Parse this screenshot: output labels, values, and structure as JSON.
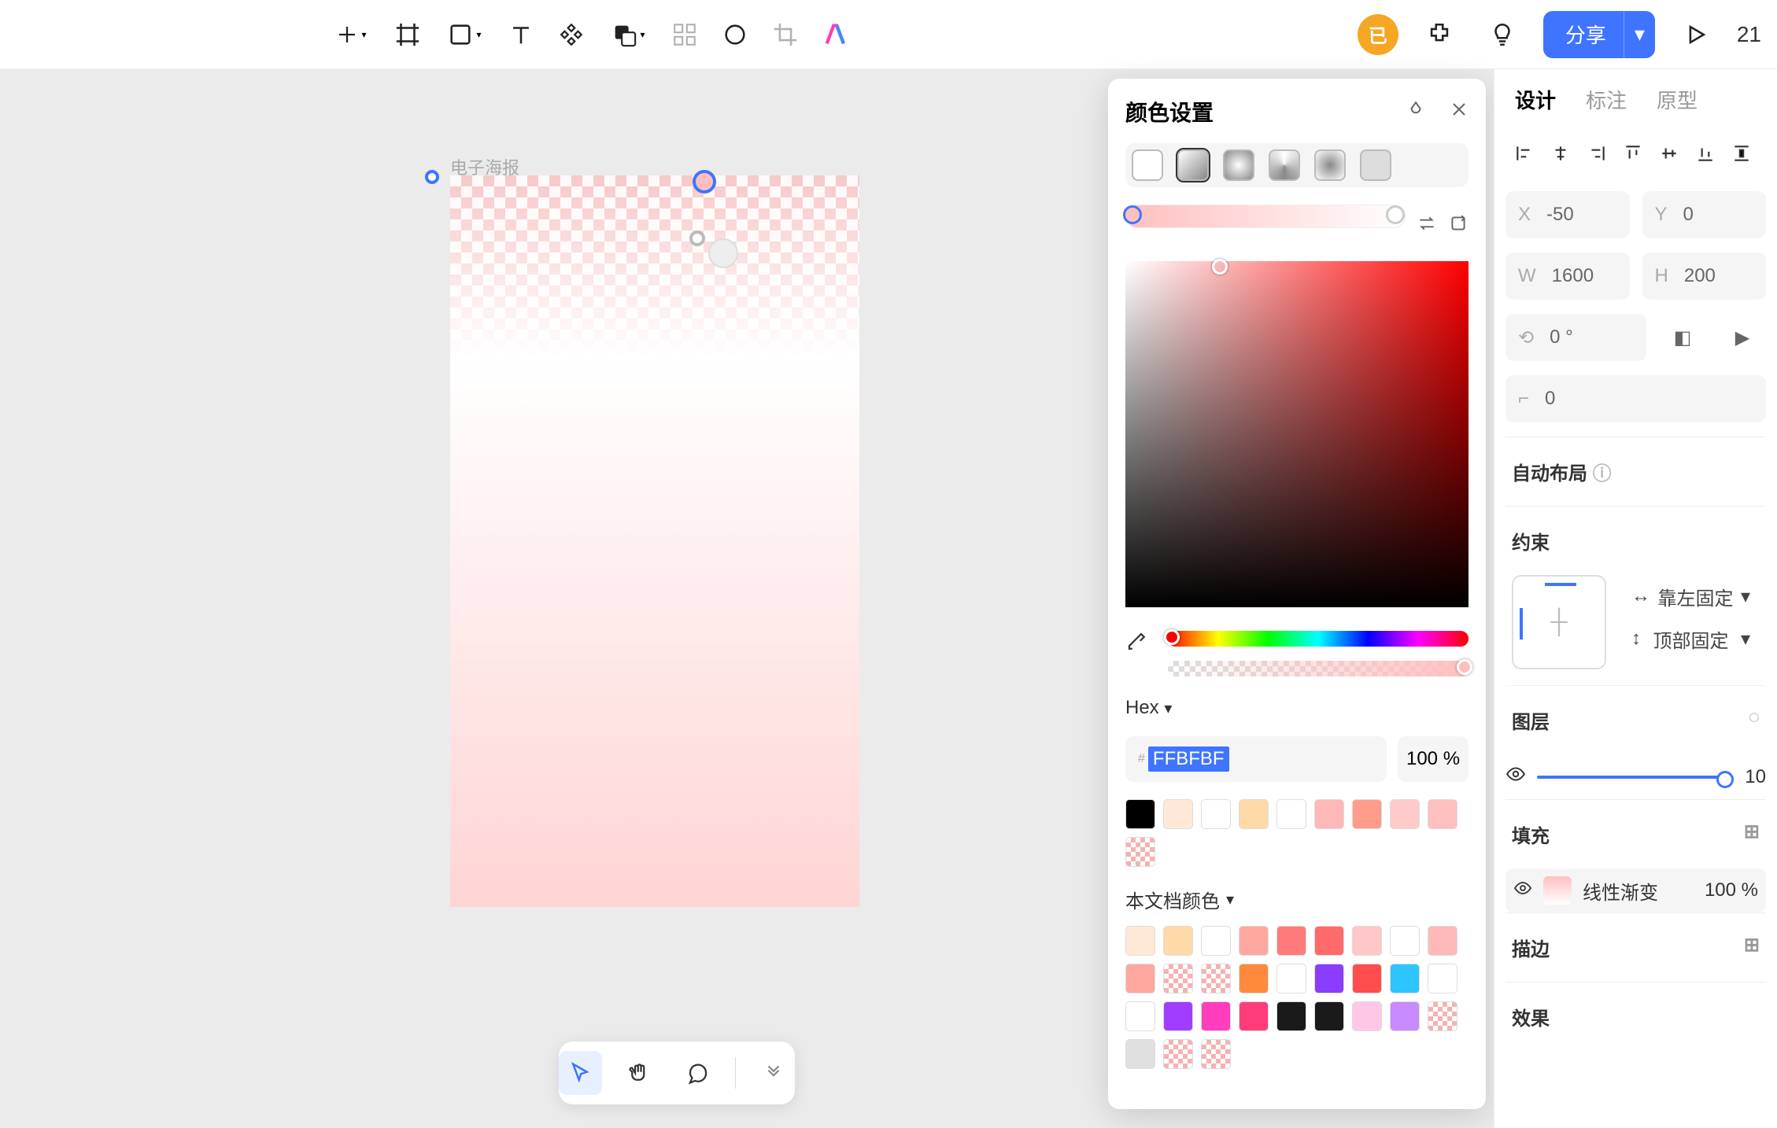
{
  "toolbar": {
    "badge": "已",
    "shareLabel": "分享",
    "percent": "21"
  },
  "canvas": {
    "frameLabel": "电子海报"
  },
  "colorPopup": {
    "title": "颜色设置",
    "hexMode": "Hex",
    "hexValue": "FFBFBF",
    "opacity": "100",
    "opacityUnit": "%",
    "docColorsLabel": "本文档颜色",
    "swatches1": [
      "#000000",
      "#ffe9d6",
      "#ffffff",
      "#ffd9a8",
      "#ffffff",
      "#ffb8b8",
      "#ff9c8a",
      "#ffcaca",
      "#ffbfbf",
      "transparent"
    ],
    "docSwatches": [
      "#ffe9d6",
      "#ffd9a8",
      "#ffffff",
      "#ffa8a0",
      "#ff7a7a",
      "#ff6a6a",
      "#ffc7c7",
      "#ffffff",
      "#ffb8b8",
      "#ffa8a0",
      "transparent",
      "transparent",
      "#ff8a3d",
      "#ffffff",
      "#8a3dff",
      "#ff4d4d",
      "#2cc5ff",
      "#ffffff",
      "#ffffff",
      "#a03dff",
      "#ff3dbd",
      "#ff3d7a",
      "#1a1a1a",
      "#1a1a1a",
      "#ffc7e6",
      "#c78aff",
      "transparent",
      "#e0e0e0",
      "transparent",
      "transparent"
    ]
  },
  "rightPanel": {
    "tabs": {
      "design": "设计",
      "annotate": "标注",
      "prototype": "原型"
    },
    "x": "-50",
    "y": "0",
    "w": "1600",
    "h": "200",
    "rotation": "0 °",
    "radius": "0",
    "autoLayoutLabel": "自动布局",
    "constraintsLabel": "约束",
    "constraintH": "靠左固定",
    "constraintV": "顶部固定",
    "layerLabel": "图层",
    "layerOpacity": "10",
    "fillLabel": "填充",
    "fillType": "线性渐变",
    "fillOpacity": "100",
    "fillUnit": "%",
    "strokeLabel": "描边",
    "effectsLabel": "效果"
  }
}
